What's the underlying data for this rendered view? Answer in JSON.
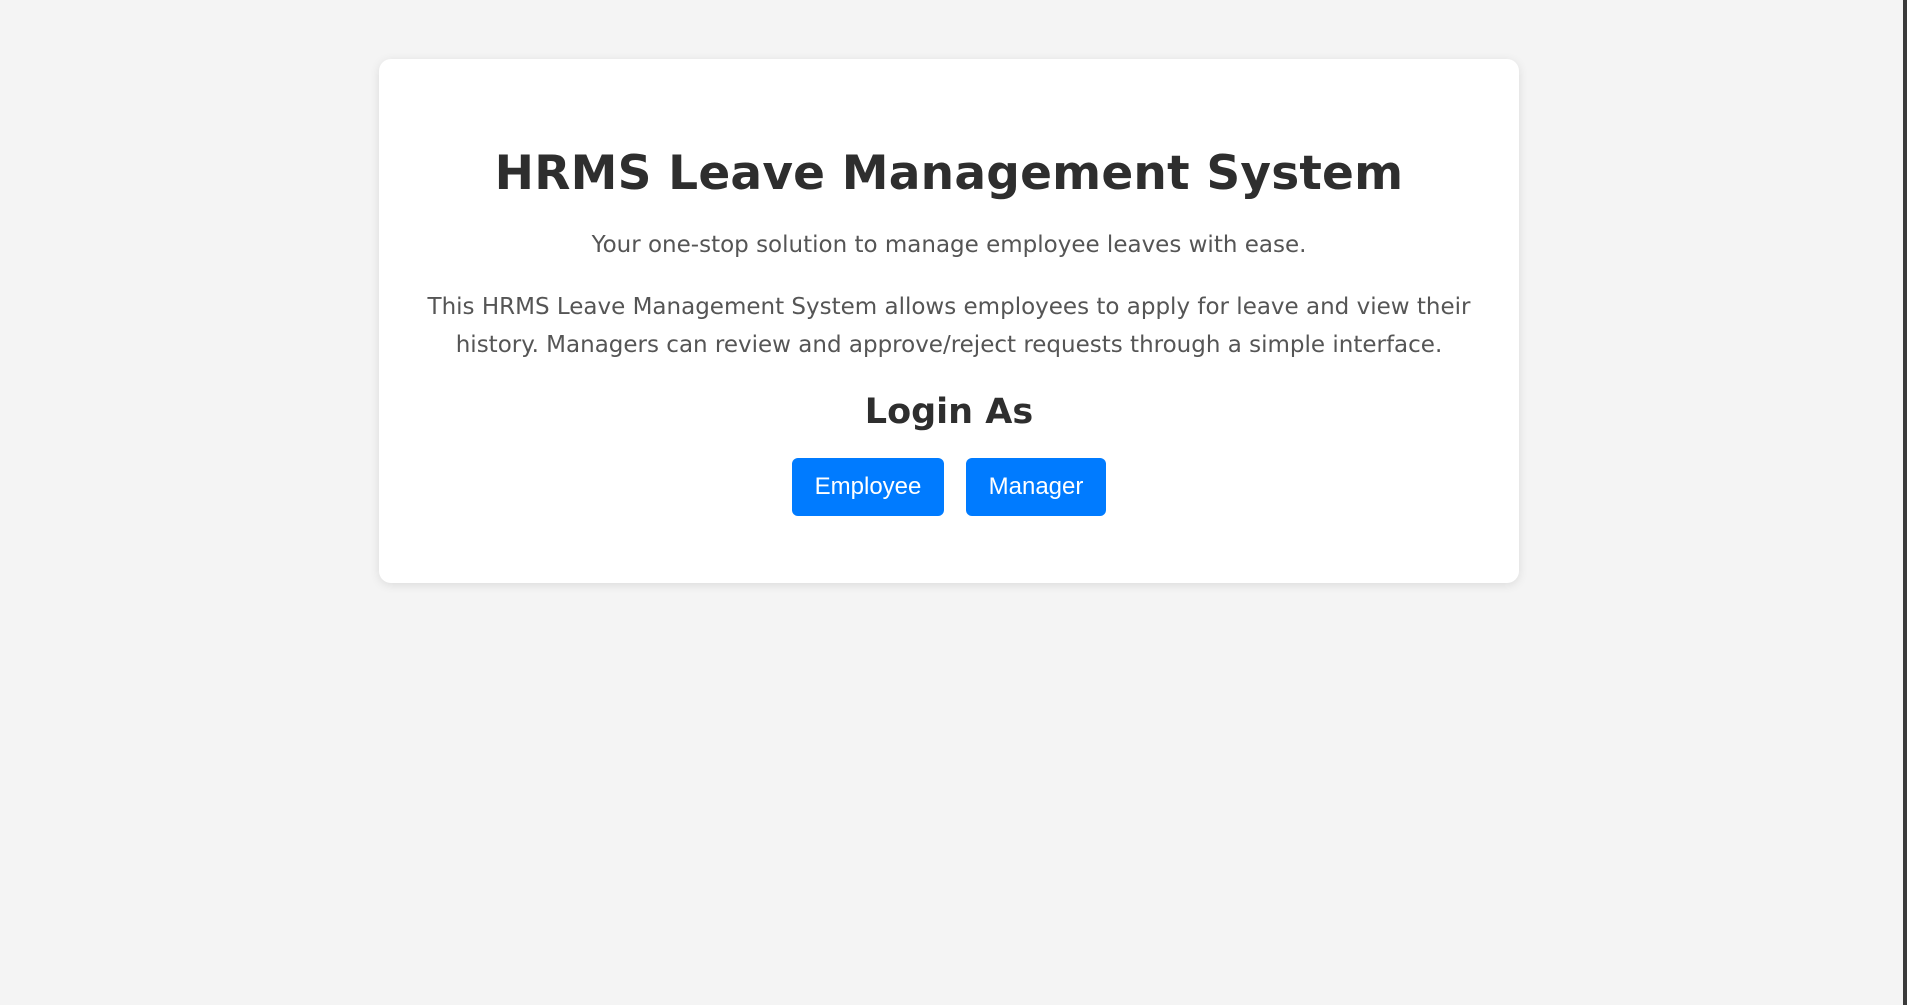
{
  "page": {
    "title": "HRMS Leave Management System",
    "tagline": "Your one-stop solution to manage employee leaves with ease.",
    "description": "This HRMS Leave Management System allows employees to apply for leave and view their history. Managers can review and approve/reject requests through a simple interface.",
    "login_heading": "Login As"
  },
  "buttons": {
    "employee_label": "Employee",
    "manager_label": "Manager"
  },
  "colors": {
    "background": "#f4f4f4",
    "card": "#ffffff",
    "button": "#007bff",
    "heading_text": "#2e2e2e",
    "body_text": "#555555"
  }
}
